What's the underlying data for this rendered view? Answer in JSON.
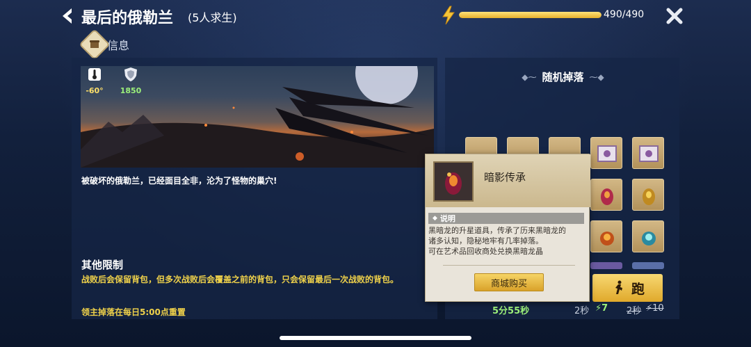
{
  "header": {
    "title": "最后的俄勒兰",
    "subtitle": "(5人求生)",
    "energy_text": "490/490",
    "energy_fraction": 1.0
  },
  "info_tab": {
    "label": "信息"
  },
  "stats": {
    "temperature": "-60°",
    "defense": "1850"
  },
  "description": "被破坏的俄勒兰，已经面目全非，沦为了怪物的巢穴!",
  "rules": {
    "title": "其他限制",
    "text": "战败后会保留背包，但多次战败后会覆盖之前的背包，只会保留最后一次战败的背包。",
    "reset": "领主掉落在每日5:00点重置"
  },
  "drops": {
    "header": "随机掉落"
  },
  "tooltip": {
    "item_name": "暗影传承",
    "section_label": "说明",
    "line1": "黑暗龙的升星道具，传承了历来黑暗龙的",
    "line2": "诸多认知，隐秘地牢有几率掉落。",
    "line3": "可在艺术品回收商处兑换黑暗龙晶",
    "buy_label": "商城购买"
  },
  "run": {
    "label": "跑",
    "countdown": "5分55秒",
    "time_now": "2秒",
    "cost_now": "7",
    "time_old": "2秒",
    "cost_old": "10"
  },
  "colors": {
    "accent_gold": "#f0d24a",
    "green": "#9cf07a"
  }
}
